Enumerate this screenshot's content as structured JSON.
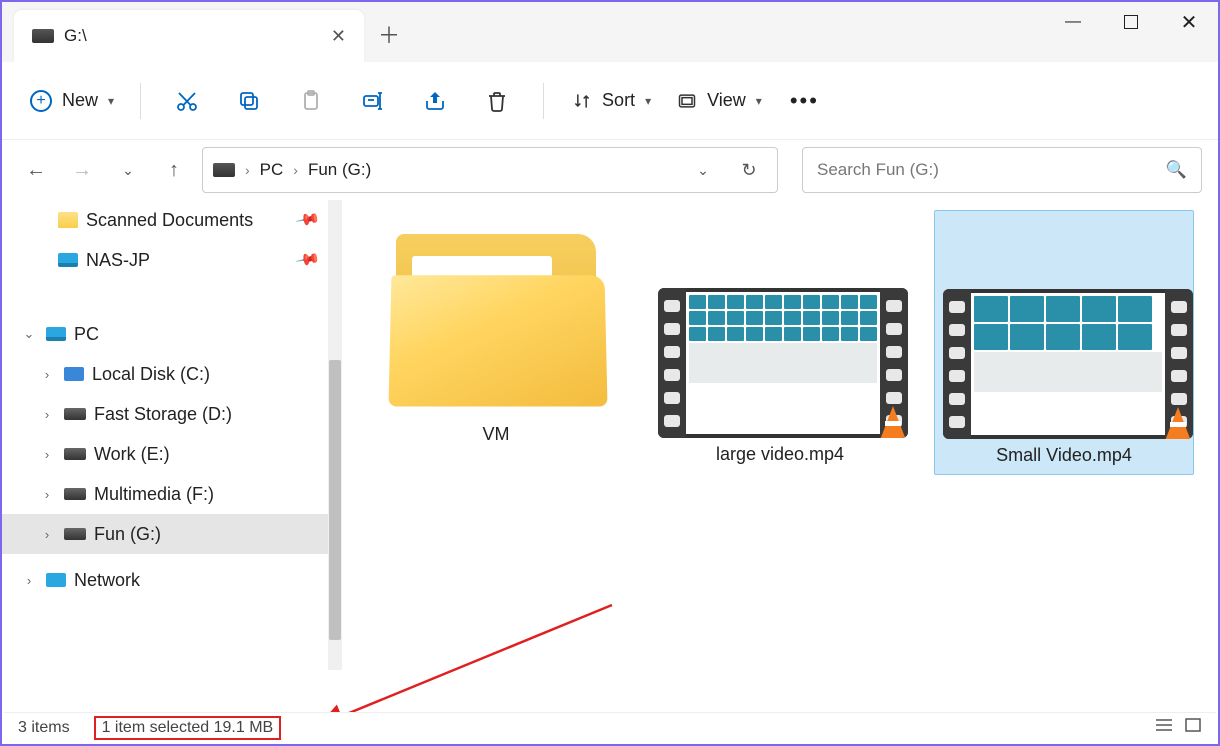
{
  "tab": {
    "title": "G:\\"
  },
  "toolbar": {
    "new_label": "New",
    "sort_label": "Sort",
    "view_label": "View"
  },
  "breadcrumb": {
    "pc": "PC",
    "drive": "Fun (G:)"
  },
  "search": {
    "placeholder": "Search Fun (G:)"
  },
  "sidebar": {
    "quick": [
      {
        "label": "Scanned Documents"
      },
      {
        "label": "NAS-JP"
      }
    ],
    "pc_label": "PC",
    "drives": [
      {
        "label": "Local Disk (C:)"
      },
      {
        "label": "Fast Storage (D:)"
      },
      {
        "label": "Work (E:)"
      },
      {
        "label": "Multimedia (F:)"
      },
      {
        "label": "Fun (G:)"
      }
    ],
    "network_label": "Network"
  },
  "items": [
    {
      "name": "VM",
      "type": "folder"
    },
    {
      "name": "large video.mp4",
      "type": "video"
    },
    {
      "name": "Small Video.mp4",
      "type": "video",
      "selected": true
    }
  ],
  "status": {
    "count": "3 items",
    "selection": "1 item selected  19.1 MB"
  }
}
